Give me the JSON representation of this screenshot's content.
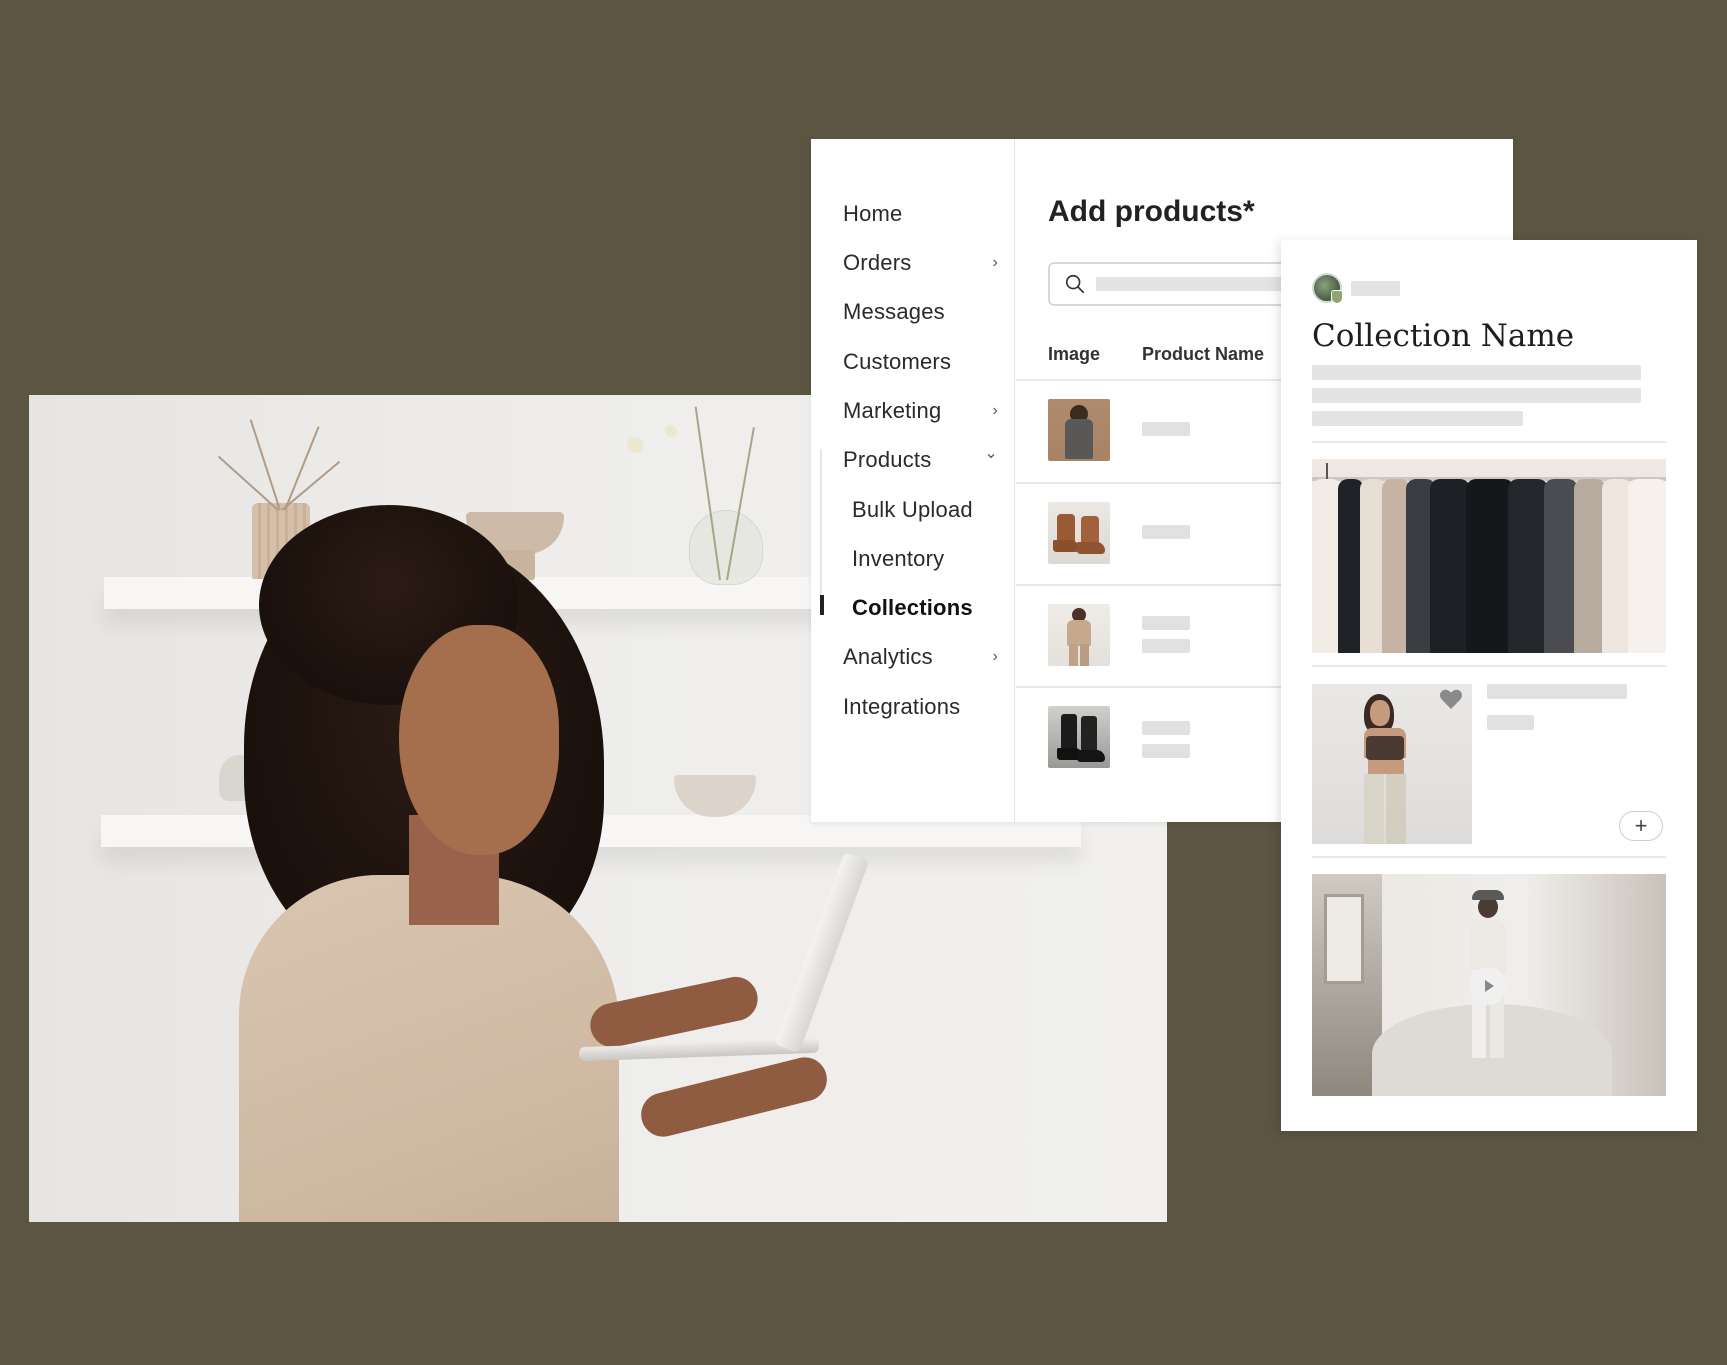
{
  "colors": {
    "background": "#5b5541",
    "panel": "#ffffff",
    "placeholder": "#e3e3e3",
    "text": "#222222"
  },
  "sidebar": {
    "items": [
      {
        "label": "Home",
        "icon": "",
        "active": false
      },
      {
        "label": "Orders",
        "icon": "chevron-right-icon",
        "active": false
      },
      {
        "label": "Messages",
        "icon": "",
        "active": false
      },
      {
        "label": "Customers",
        "icon": "",
        "active": false
      },
      {
        "label": "Marketing",
        "icon": "chevron-right-icon",
        "active": false
      },
      {
        "label": "Products",
        "icon": "chevron-down-icon",
        "active": false
      },
      {
        "label": "Bulk Upload",
        "icon": "",
        "active": false
      },
      {
        "label": "Inventory",
        "icon": "",
        "active": false
      },
      {
        "label": "Collections",
        "icon": "",
        "active": true
      },
      {
        "label": "Analytics",
        "icon": "chevron-right-icon",
        "active": false
      },
      {
        "label": "Integrations",
        "icon": "",
        "active": false
      }
    ],
    "chevron_right": "›",
    "chevron_down": "⌄"
  },
  "main": {
    "title": "Add products*",
    "search": {
      "placeholder": "",
      "icon": "search-icon"
    },
    "columns": [
      "Image",
      "Product Name"
    ],
    "rows": [
      {
        "image": "blazer-suit-photo"
      },
      {
        "image": "brown-chelsea-boots-photo"
      },
      {
        "image": "beige-suit-photo"
      },
      {
        "image": "black-combat-boots-photo"
      }
    ]
  },
  "collection": {
    "title": "Collection Name",
    "hero_image": "clothing-rack-photo",
    "product_image": "model-crop-top-photo",
    "favorite_icon": "heart-icon",
    "add_label": "+",
    "video_thumbnail": "studio-model-video",
    "play_icon": "play-icon"
  },
  "hero": {
    "image": "woman-holding-laptop-photo"
  }
}
